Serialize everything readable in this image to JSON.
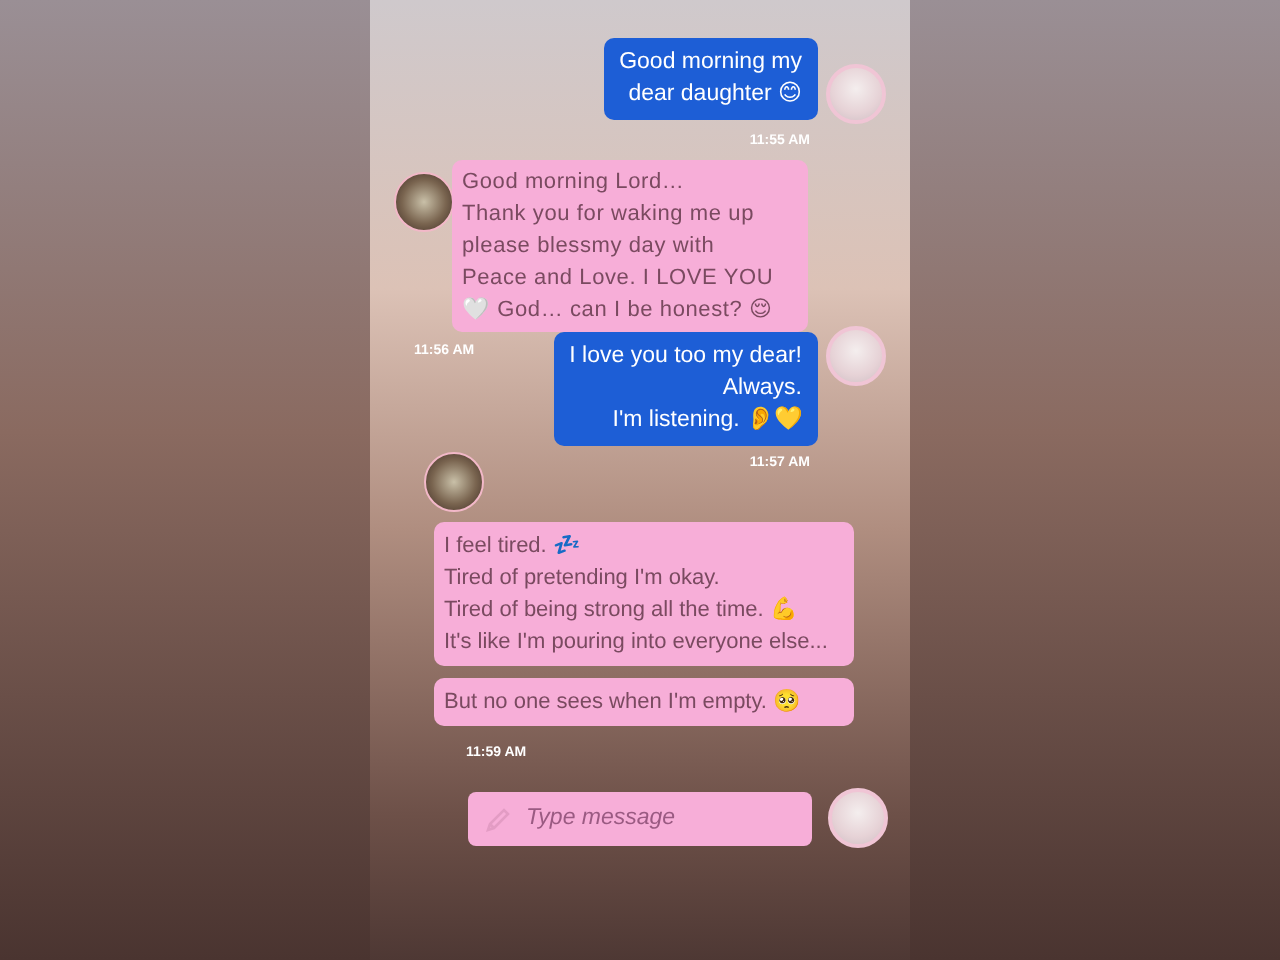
{
  "feed": [
    {
      "kind": "outgoing",
      "text": "Good morning my\ndear daughter 😊",
      "time": "11:55 AM"
    },
    {
      "kind": "incoming",
      "text": "Good morning Lord…\nThank you for waking me up\nplease blessmy day with\nPeace and Love. I LOVE YOU\n🤍 God… can I be honest? 😌",
      "time": "11:56 AM"
    },
    {
      "kind": "outgoing",
      "text": "I love you too my dear!\nAlways.\nI'm listening. 👂💛",
      "time": "11:57 AM"
    },
    {
      "kind": "incoming-stacked",
      "bubbles": [
        "I feel tired. 💤\nTired of pretending I'm okay.\nTired of being strong all the time. 💪\nIt's like I'm pouring into everyone else...",
        "But no one sees when I'm empty. 🥺"
      ],
      "time": "11:59 AM"
    }
  ],
  "composer": {
    "placeholder": "Type message"
  }
}
